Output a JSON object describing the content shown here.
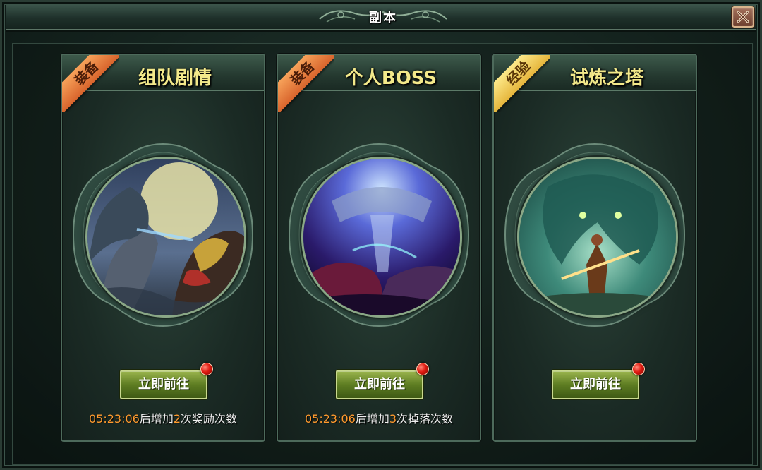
{
  "window": {
    "title": "副本",
    "close_icon": "close-icon"
  },
  "cards": [
    {
      "badge": "装备",
      "badge_color": "#e67a36",
      "title": "组队剧情",
      "button_label": "立即前往",
      "timer": "05:23:06",
      "timer_suffix_pre": "后增加",
      "count": "2",
      "timer_suffix_post": "次奖励次数"
    },
    {
      "badge": "装备",
      "badge_color": "#e67a36",
      "title": "个人BOSS",
      "button_label": "立即前往",
      "timer": "05:23:06",
      "timer_suffix_pre": "后增加",
      "count": "3",
      "timer_suffix_post": "次掉落次数"
    },
    {
      "badge": "经验",
      "badge_color": "#f2c94c",
      "title": "试炼之塔",
      "button_label": "立即前往"
    }
  ],
  "colors": {
    "accent_gold": "#f3e98a",
    "timer_orange": "#ff9a2e",
    "button_green": "#5e7d22",
    "notification_red": "#e01a10"
  }
}
